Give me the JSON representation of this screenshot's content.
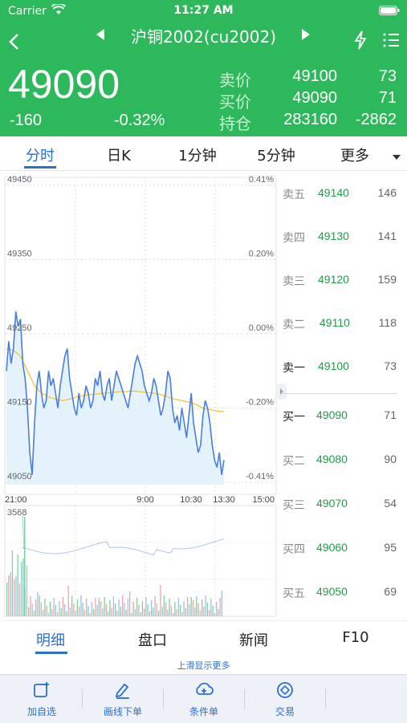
{
  "status_bar": {
    "carrier": "Carrier",
    "time": "11:27 AM"
  },
  "nav": {
    "title": "沪铜2002(cu2002)"
  },
  "quote": {
    "last_price": "49090",
    "change": "-160",
    "change_pct": "-0.32%",
    "rows": [
      {
        "label": "卖价",
        "price": "49100",
        "volume": "73"
      },
      {
        "label": "买价",
        "price": "49090",
        "volume": "71"
      },
      {
        "label": "持仓",
        "price": "283160",
        "volume": "-2862"
      }
    ]
  },
  "chart_tabs": [
    {
      "label": "分时",
      "active": true
    },
    {
      "label": "日K"
    },
    {
      "label": "1分钟"
    },
    {
      "label": "5分钟"
    },
    {
      "label": "更多"
    }
  ],
  "chart_data": {
    "type": "line",
    "y_ticks": [
      "49450",
      "49350",
      "49250",
      "49150",
      "49050"
    ],
    "pct_ticks": [
      "0.41%",
      "0.20%",
      "0.00%",
      "-0.20%",
      "-0.41%"
    ],
    "x_ticks": [
      "21:00",
      "9:00",
      "10:30",
      "13:30",
      "15:00"
    ],
    "ylim": [
      49050,
      49450
    ],
    "volume_max_label": "3568",
    "series": [
      {
        "values": [
          49200,
          49240,
          49210,
          49230,
          49280,
          49260,
          49270,
          49210,
          49190,
          49150,
          49090,
          49060,
          49130,
          49180,
          49200,
          49170,
          49150,
          49160,
          49200,
          49180,
          49190,
          49170,
          49150,
          49180,
          49200,
          49220,
          49230,
          49190,
          49170,
          49150,
          49140,
          49170,
          49150,
          49160,
          49180,
          49170,
          49150,
          49160,
          49190,
          49180,
          49200,
          49170,
          49160,
          49180,
          49190,
          49160,
          49180,
          49200,
          49190,
          49180,
          49170,
          49160,
          49150,
          49170,
          49190,
          49210,
          49220,
          49210,
          49200,
          49180,
          49170,
          49160,
          49170,
          49190,
          49180,
          49160,
          49140,
          49150,
          49170,
          49200,
          49190,
          49150,
          49130,
          49140,
          49120,
          49150,
          49130,
          49110,
          49140,
          49170,
          49130,
          49110,
          49090,
          49100,
          49140,
          49160,
          49150,
          49130,
          49100,
          49080,
          49070,
          49090,
          49060,
          49080
        ]
      },
      {
        "values": [
          49230,
          49228,
          49220,
          49200,
          49180,
          49170,
          49165,
          49162,
          49160,
          49162,
          49165,
          49167,
          49168,
          49169,
          49170,
          49171,
          49172,
          49172,
          49173,
          49172,
          49171,
          49170,
          49168,
          49165,
          49162,
          49160,
          49158,
          49155,
          49150,
          49148,
          49146,
          49145
        ]
      }
    ]
  },
  "order_book": {
    "asks": [
      {
        "label": "卖五",
        "price": "49140",
        "volume": "146"
      },
      {
        "label": "卖四",
        "price": "49130",
        "volume": "141"
      },
      {
        "label": "卖三",
        "price": "49120",
        "volume": "159"
      },
      {
        "label": "卖二",
        "price": "49110",
        "volume": "118"
      },
      {
        "label": "卖一",
        "price": "49100",
        "volume": "73"
      }
    ],
    "bids": [
      {
        "label": "买一",
        "price": "49090",
        "volume": "71"
      },
      {
        "label": "买二",
        "price": "49080",
        "volume": "90"
      },
      {
        "label": "买三",
        "price": "49070",
        "volume": "54"
      },
      {
        "label": "买四",
        "price": "49060",
        "volume": "95"
      },
      {
        "label": "买五",
        "price": "49050",
        "volume": "69"
      }
    ]
  },
  "bottom_tabs": [
    {
      "label": "明细",
      "active": true
    },
    {
      "label": "盘口"
    },
    {
      "label": "新闻"
    },
    {
      "label": "F10"
    }
  ],
  "hint": "上滑显示更多",
  "toolbar": [
    {
      "label": "加自选",
      "icon": "add-watchlist-icon"
    },
    {
      "label": "画线下单",
      "icon": "draw-line-icon"
    },
    {
      "label": "条件单",
      "icon": "cloud-order-icon"
    },
    {
      "label": "交易",
      "icon": "trade-icon"
    }
  ],
  "colors": {
    "header_green": "#2eb85c",
    "accent_blue": "#2b6fd1",
    "price_line": "#4a7ee0",
    "avg_line": "#f2c23a"
  }
}
